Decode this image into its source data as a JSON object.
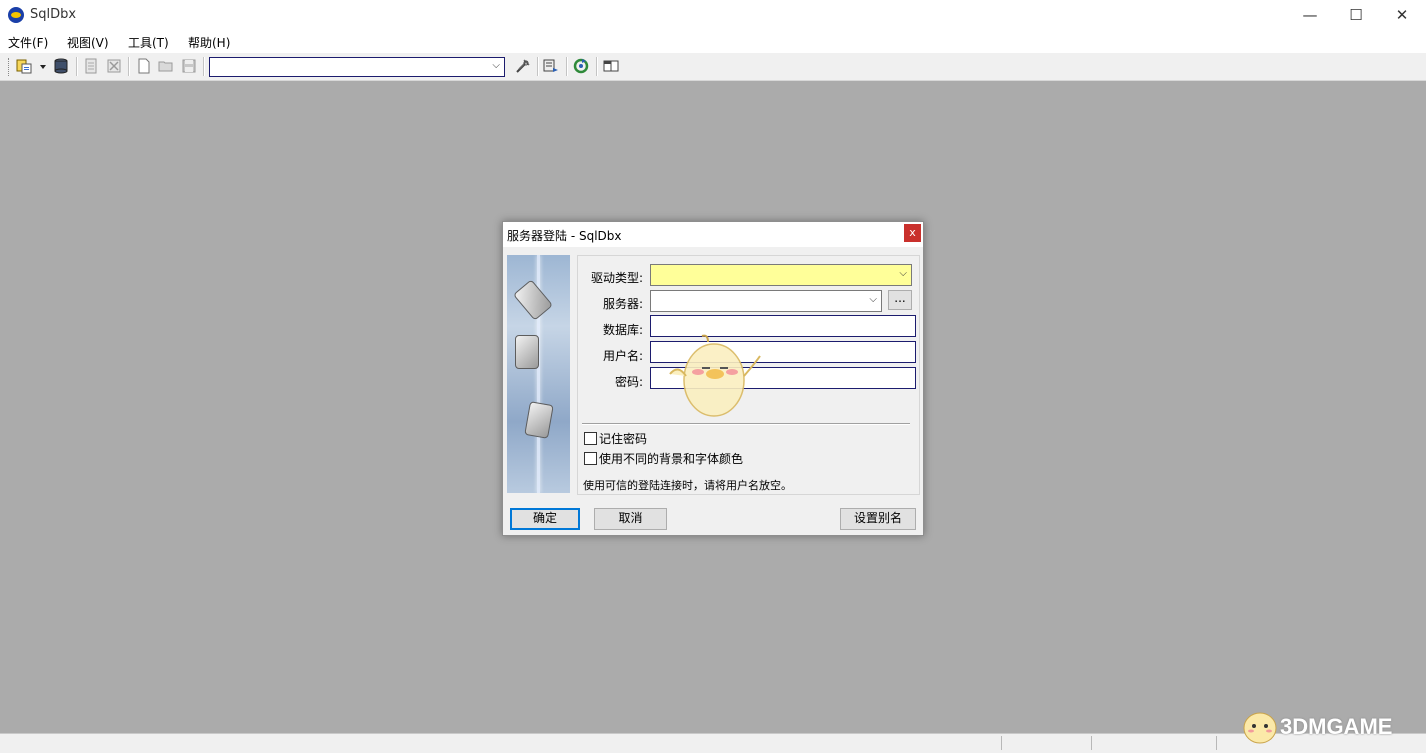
{
  "app": {
    "title": "SqlDbx",
    "minimize": "—",
    "maximize": "☐",
    "close": "✕"
  },
  "menu": [
    "文件(F)",
    "视图(V)",
    "工具(T)",
    "帮助(H)"
  ],
  "toolbar": {
    "connection_combo_value": "",
    "icons": [
      "new-connection-icon",
      "dropdown-arrow-icon",
      "database-icon",
      "disconnect-icon",
      "close-tab-icon",
      "new-file-icon",
      "open-file-icon",
      "save-icon",
      "tools-icon",
      "execute-icon",
      "refresh-icon",
      "layout-icon"
    ]
  },
  "dialog": {
    "title": "服务器登陆 - SqlDbx",
    "close": "x",
    "fields": {
      "driver_label": "驱动类型:",
      "driver_value": "",
      "server_label": "服务器:",
      "server_value": "",
      "browse": "...",
      "database_label": "数据库:",
      "database_value": "",
      "user_label": "用户名:",
      "user_value": "",
      "password_label": "密码:",
      "password_value": ""
    },
    "remember_password": "记住密码",
    "different_colors": "使用不同的背景和字体颜色",
    "hint": "使用可信的登陆连接时，请将用户名放空。",
    "ok": "确定",
    "cancel": "取消",
    "alias": "设置别名",
    "colors": {
      "driver_bg": "#ffff99",
      "accent": "#0078d7",
      "close_bg": "#c9302c"
    }
  },
  "watermark": {
    "text": "3DMGAME"
  }
}
